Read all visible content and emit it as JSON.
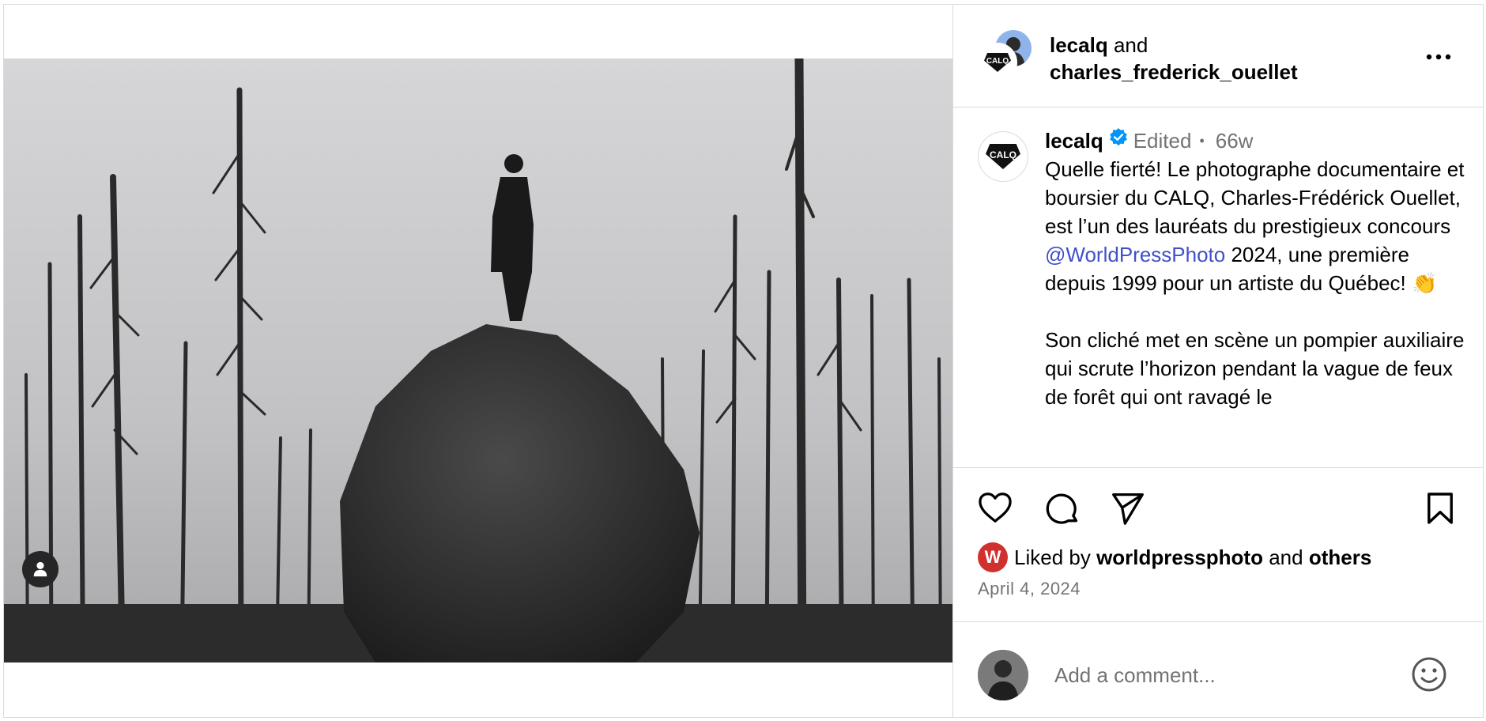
{
  "post": {
    "header": {
      "user1": "lecalq",
      "joiner": " and ",
      "user2": "charles_frederick_ouellet",
      "more_icon": "more-horizontal-icon"
    },
    "caption": {
      "username": "lecalq",
      "verified": true,
      "edited": "Edited",
      "separator": "•",
      "age": "66w",
      "line1": "Quelle fierté! Le photographe documentaire et boursier du CALQ, Charles-Frédérick Ouellet, est l’un des lauréats du prestigieux concours ",
      "mention": "@WorldPressPhoto",
      "line2": " 2024, une première depuis 1999 pour un artiste du Québec! 👏",
      "para2": "Son cliché met en scène un pompier auxiliaire qui scrute l’horizon pendant la vague de feux de forêt qui ont ravagé le"
    },
    "avatars": {
      "calq_logo_text": "CALQ"
    },
    "likes": {
      "badge_letter": "W",
      "prefix": "Liked by ",
      "user": "worldpressphoto",
      "joiner": " and ",
      "others": "others"
    },
    "date": "April 4, 2024",
    "comment": {
      "placeholder": "Add a comment..."
    }
  },
  "colors": {
    "mention": "#4150c8",
    "verified": "#0095f6",
    "muted": "#737373",
    "badge": "#d0302e"
  }
}
